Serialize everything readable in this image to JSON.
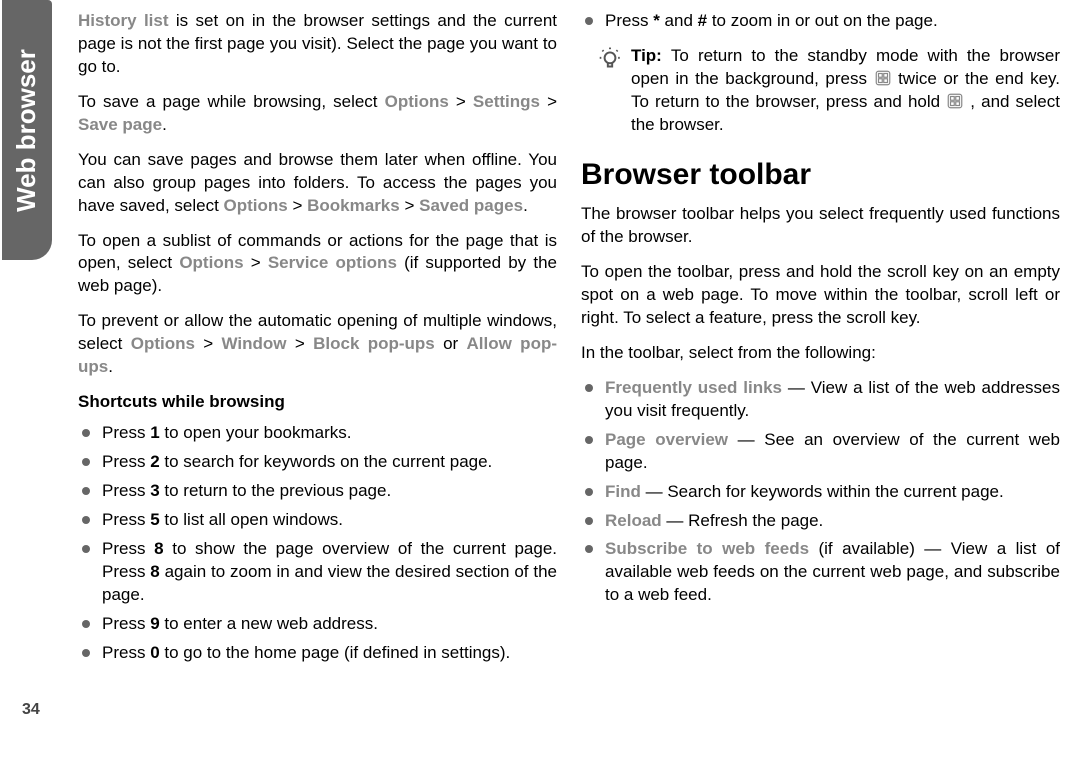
{
  "sideTab": {
    "label": "Web browser"
  },
  "pageNumber": "34",
  "left": {
    "p1_a": "History list",
    "p1_b": " is set on in the browser settings and the current page is not the first page you visit). Select the page you want to go to.",
    "p2_a": "To save a page while browsing, select ",
    "p2_opt": "Options",
    "p2_gt1": " > ",
    "p2_set": "Settings",
    "p2_gt2": " > ",
    "p2_save": "Save page",
    "p2_end": ".",
    "p3_a": "You can save pages and browse them later when offline. You can also group pages into folders. To access the pages you have saved, select ",
    "p3_opt": "Options",
    "p3_gt1": " > ",
    "p3_bm": "Bookmarks",
    "p3_gt2": " > ",
    "p3_sp": "Saved pages",
    "p3_end": ".",
    "p4_a": "To open a sublist of commands or actions for the page that is open, select ",
    "p4_opt": "Options",
    "p4_gt1": " > ",
    "p4_so": "Service options",
    "p4_b": " (if supported by the web page).",
    "p5_a": "To prevent or allow the automatic opening of multiple windows, select ",
    "p5_opt": "Options",
    "p5_gt1": " > ",
    "p5_win": "Window",
    "p5_gt2": " > ",
    "p5_block": "Block pop-ups",
    "p5_or": " or ",
    "p5_allow": "Allow pop-ups",
    "p5_end": ".",
    "shortcutsHead": "Shortcuts while browsing",
    "s1_a": "Press ",
    "s1_b": "1",
    "s1_c": " to open your bookmarks.",
    "s2_a": "Press ",
    "s2_b": "2",
    "s2_c": " to search for keywords on the current page.",
    "s3_a": "Press ",
    "s3_b": "3",
    "s3_c": " to return to the previous page.",
    "s4_a": "Press ",
    "s4_b": "5",
    "s4_c": " to list all open windows.",
    "s5_a": "Press ",
    "s5_b": "8",
    "s5_c": " to show the page overview of the current page. Press ",
    "s5_d": "8",
    "s5_e": " again to zoom in and view the desired section of the page.",
    "s6_a": "Press ",
    "s6_b": "9",
    "s6_c": " to enter a new web address.",
    "s7_a": "Press ",
    "s7_b": "0",
    "s7_c": " to go to the home page (if defined in settings)."
  },
  "right": {
    "zoom_a": "Press ",
    "zoom_b": "*",
    "zoom_c": " and ",
    "zoom_d": "#",
    "zoom_e": " to zoom in or out on the page.",
    "tip_label": "Tip: ",
    "tip_a": " To return to the standby mode with the browser open in the background, press ",
    "tip_b": " twice or the end key. To return to the browser, press and hold ",
    "tip_c": " , and select the browser.",
    "toolbarHead": "Browser toolbar",
    "t1": "The browser toolbar helps you select frequently used functions of the browser.",
    "t2": "To open the toolbar, press and hold the scroll key on an empty spot on a web page. To move within the toolbar, scroll left or right. To select a feature, press the scroll key.",
    "t3": "In the toolbar, select from the following:",
    "b1_lab": "Frequently used links",
    "b1_txt": " — View a list of the web addresses you visit frequently.",
    "b2_lab": "Page overview",
    "b2_txt": " — See an overview of the current web page.",
    "b3_lab": "Find",
    "b3_txt": " — Search for keywords within the current page.",
    "b4_lab": "Reload",
    "b4_txt": " — Refresh the page.",
    "b5_lab": "Subscribe to web feeds",
    "b5_txt": " (if available) — View a list of available web feeds on the current web page, and subscribe to a web feed."
  }
}
